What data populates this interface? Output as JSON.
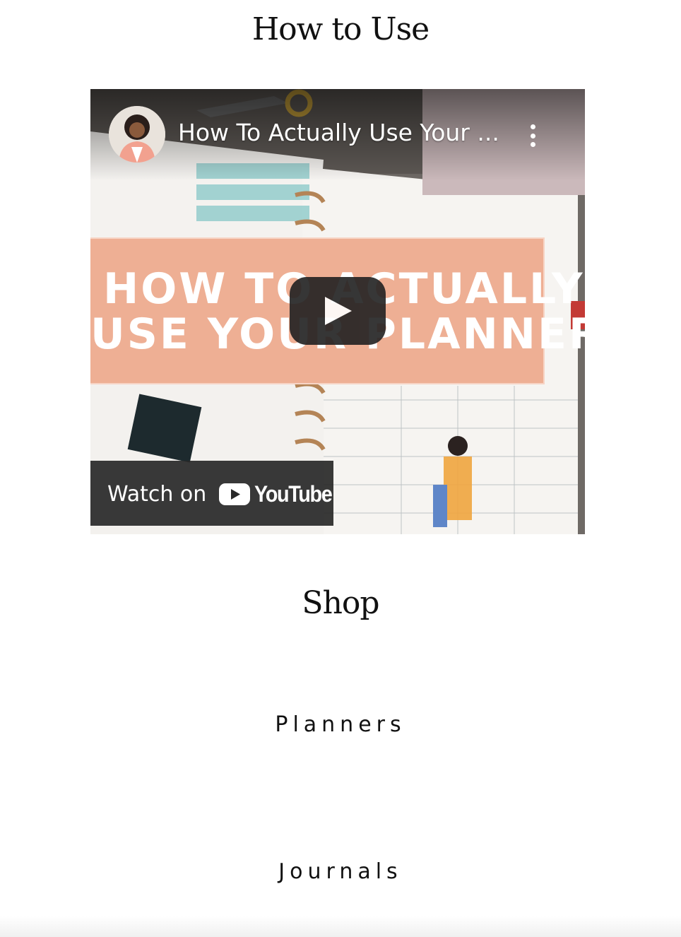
{
  "how_to_use": {
    "title": "How to Use",
    "video": {
      "title": "How To Actually Use Your ...",
      "banner_lines": [
        "HOW TO ACTUALLY",
        "USE YOUR PLANNER"
      ],
      "watch_label": "Watch on",
      "youtube_word": "YouTube",
      "colors": {
        "banner": "#eeaf94",
        "play_button": "#212121",
        "youtube_red": "#ff0000"
      }
    }
  },
  "shop": {
    "title": "Shop",
    "links": [
      "Planners",
      "Journals"
    ]
  }
}
